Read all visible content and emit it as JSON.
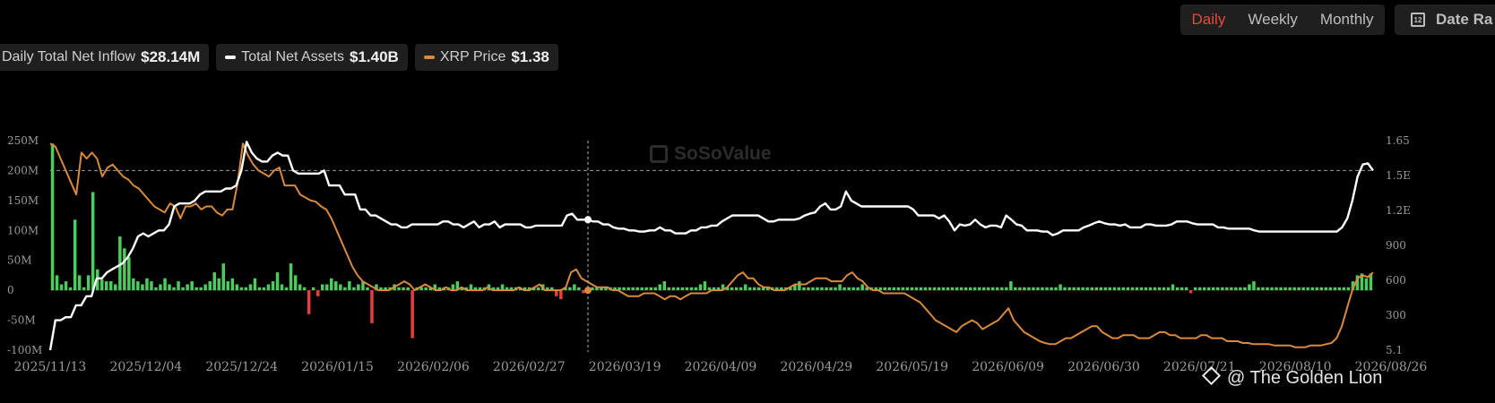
{
  "tabs": {
    "items": [
      {
        "label": "Daily",
        "active": true
      },
      {
        "label": "Weekly",
        "active": false
      },
      {
        "label": "Monthly",
        "active": false
      }
    ]
  },
  "date_range": {
    "label": "Date Ra",
    "icon": "calendar-icon",
    "icon_text": "12"
  },
  "legend": [
    {
      "label": "Daily Total Net Inflow",
      "value": "$28.14M",
      "color": "#4ecb5e"
    },
    {
      "label": "Total Net Assets",
      "value": "$1.40B",
      "color": "#ffffff"
    },
    {
      "label": "XRP Price",
      "value": "$1.38",
      "color": "#d98a3c"
    }
  ],
  "watermark": {
    "text": "SoSoValue",
    "icon": "sosovalue-logo-icon"
  },
  "credit": {
    "text": "@ The Golden Lion",
    "icon": "binance-icon"
  },
  "colors": {
    "positive": "#4ecb5e",
    "negative": "#e63f3f",
    "assets": "#ffffff",
    "price": "#d98a3c",
    "grid": "#2a2a2a"
  },
  "chart_data": {
    "type": "bar",
    "x_tick_labels": [
      "2025/11/13",
      "2025/12/04",
      "2025/12/24",
      "2026/01/15",
      "2026/02/06",
      "2026/02/27",
      "2026/03/19",
      "2026/04/09",
      "2026/04/29",
      "2026/05/19",
      "2026/06/09",
      "2026/06/30",
      "2026/07/21",
      "2026/08/10",
      "2026/08/26"
    ],
    "y_left_ticks": [
      "250M",
      "200M",
      "150M",
      "100M",
      "50M",
      "0",
      "-50M",
      "-100M"
    ],
    "y_left_ticks_values": [
      250,
      200,
      150,
      100,
      50,
      0,
      -50,
      -100
    ],
    "y_right_ticks": [
      "1.65",
      "1.5E",
      "1.2E",
      "900",
      "600",
      "300",
      "5.1"
    ],
    "y_right_ticks_values": [
      1650,
      1500,
      1200,
      900,
      600,
      300,
      50
    ],
    "ylim_left": [
      -100,
      250
    ],
    "ylim_right": [
      0,
      1650
    ],
    "series": [
      {
        "name": "Daily Total Net Inflow",
        "unit": "M",
        "type": "bar",
        "values": [
          245,
          25,
          10,
          15,
          5,
          118,
          25,
          5,
          25,
          164,
          35,
          18,
          15,
          15,
          10,
          90,
          70,
          55,
          20,
          15,
          10,
          20,
          15,
          5,
          10,
          20,
          10,
          5,
          15,
          5,
          10,
          15,
          5,
          5,
          10,
          15,
          30,
          20,
          45,
          15,
          20,
          10,
          5,
          5,
          10,
          20,
          5,
          5,
          10,
          15,
          30,
          10,
          5,
          45,
          25,
          10,
          5,
          -40,
          5,
          -10,
          10,
          10,
          20,
          15,
          10,
          5,
          15,
          5,
          10,
          15,
          5,
          -55,
          10,
          5,
          5,
          5,
          10,
          5,
          5,
          5,
          -80,
          5,
          5,
          5,
          5,
          10,
          5,
          5,
          5,
          10,
          15,
          5,
          5,
          10,
          5,
          5,
          5,
          10,
          5,
          5,
          10,
          5,
          5,
          5,
          5,
          5,
          5,
          5,
          5,
          10,
          5,
          5,
          -10,
          -15,
          5,
          5,
          10,
          5,
          -5,
          5,
          5,
          5,
          5,
          5,
          5,
          5,
          5,
          5,
          5,
          5,
          5,
          5,
          5,
          5,
          5,
          10,
          15,
          5,
          5,
          5,
          5,
          5,
          5,
          5,
          10,
          15,
          5,
          5,
          5,
          10,
          5,
          5,
          5,
          5,
          10,
          5,
          5,
          5,
          5,
          5,
          5,
          5,
          5,
          5,
          5,
          10,
          15,
          5,
          5,
          5,
          5,
          5,
          5,
          5,
          5,
          10,
          5,
          5,
          5,
          5,
          10,
          5,
          5,
          5,
          5,
          5,
          5,
          5,
          5,
          5,
          5,
          5,
          5,
          5,
          5,
          5,
          5,
          5,
          5,
          5,
          5,
          5,
          5,
          5,
          5,
          5,
          5,
          5,
          5,
          5,
          5,
          5,
          5,
          15,
          5,
          5,
          5,
          5,
          5,
          5,
          5,
          5,
          5,
          5,
          10,
          5,
          5,
          5,
          5,
          5,
          5,
          5,
          5,
          5,
          5,
          5,
          5,
          5,
          5,
          5,
          5,
          5,
          5,
          5,
          5,
          5,
          5,
          5,
          5,
          10,
          5,
          5,
          5,
          -5,
          5,
          5,
          5,
          5,
          5,
          5,
          5,
          5,
          5,
          5,
          5,
          5,
          10,
          15,
          5,
          5,
          5,
          5,
          5,
          5,
          5,
          5,
          5,
          5,
          5,
          5,
          5,
          5,
          5,
          5,
          5,
          5,
          5,
          5,
          5,
          15,
          25,
          28,
          20,
          28
        ]
      },
      {
        "name": "Total Net Assets",
        "type": "line",
        "values": [
          -100,
          -50,
          -50,
          -45,
          -45,
          -25,
          -25,
          -10,
          -10,
          20,
          20,
          30,
          35,
          40,
          45,
          55,
          70,
          90,
          95,
          90,
          95,
          100,
          100,
          110,
          140,
          145,
          145,
          145,
          150,
          160,
          165,
          165,
          165,
          165,
          170,
          170,
          175,
          200,
          248,
          230,
          220,
          215,
          215,
          225,
          230,
          225,
          225,
          200,
          195,
          195,
          195,
          195,
          195,
          200,
          175,
          175,
          175,
          160,
          160,
          160,
          135,
          135,
          125,
          125,
          120,
          115,
          110,
          110,
          105,
          105,
          110,
          110,
          110,
          110,
          110,
          110,
          115,
          115,
          110,
          110,
          105,
          110,
          115,
          105,
          110,
          110,
          115,
          105,
          110,
          110,
          110,
          110,
          105,
          105,
          108,
          108,
          108,
          108,
          108,
          108,
          125,
          128,
          118,
          118,
          118,
          115,
          115,
          110,
          110,
          105,
          103,
          103,
          100,
          100,
          98,
          98,
          100,
          100,
          105,
          100,
          100,
          95,
          95,
          95,
          100,
          100,
          105,
          105,
          108,
          108,
          115,
          120,
          125,
          125,
          125,
          125,
          125,
          125,
          120,
          115,
          115,
          118,
          118,
          118,
          118,
          120,
          125,
          128,
          130,
          140,
          145,
          135,
          135,
          140,
          165,
          150,
          145,
          140,
          140,
          140,
          140,
          140,
          140,
          140,
          140,
          140,
          140,
          135,
          125,
          125,
          125,
          125,
          120,
          125,
          115,
          100,
          110,
          108,
          110,
          118,
          110,
          105,
          108,
          108,
          105,
          125,
          118,
          110,
          108,
          100,
          100,
          100,
          98,
          98,
          92,
          95,
          100,
          100,
          100,
          100,
          105,
          108,
          112,
          115,
          112,
          110,
          110,
          108,
          110,
          105,
          105,
          105,
          110,
          110,
          108,
          108,
          108,
          110,
          115,
          115,
          115,
          112,
          110,
          110,
          110,
          110,
          105,
          105,
          103,
          103,
          103,
          103,
          103,
          100,
          98,
          98,
          98,
          98,
          98,
          98,
          98,
          98,
          98,
          98,
          98,
          98,
          98,
          98,
          98,
          98,
          105,
          120,
          150,
          190,
          210,
          212,
          200
        ]
      },
      {
        "name": "XRP Price",
        "type": "line",
        "values": [
          245,
          240,
          220,
          200,
          180,
          160,
          230,
          220,
          230,
          220,
          190,
          205,
          210,
          200,
          190,
          185,
          175,
          170,
          160,
          150,
          140,
          135,
          130,
          145,
          140,
          120,
          140,
          140,
          145,
          135,
          140,
          140,
          130,
          125,
          135,
          135,
          180,
          245,
          225,
          210,
          200,
          195,
          190,
          200,
          205,
          175,
          175,
          175,
          160,
          155,
          150,
          148,
          140,
          135,
          120,
          100,
          80,
          60,
          40,
          25,
          15,
          10,
          5,
          0,
          0,
          0,
          5,
          10,
          15,
          10,
          0,
          5,
          10,
          5,
          0,
          0,
          5,
          0,
          0,
          5,
          0,
          0,
          0,
          0,
          5,
          0,
          0,
          0,
          0,
          0,
          5,
          0,
          0,
          5,
          10,
          0,
          0,
          0,
          0,
          5,
          30,
          35,
          20,
          15,
          10,
          5,
          5,
          5,
          0,
          0,
          -5,
          -10,
          -10,
          -10,
          -5,
          -5,
          -5,
          -10,
          -15,
          -10,
          -10,
          -15,
          -10,
          -5,
          -5,
          -5,
          -5,
          0,
          0,
          0,
          5,
          15,
          25,
          30,
          20,
          20,
          10,
          5,
          5,
          0,
          0,
          0,
          5,
          10,
          10,
          10,
          15,
          20,
          20,
          20,
          15,
          15,
          15,
          25,
          30,
          20,
          15,
          5,
          0,
          0,
          -5,
          -5,
          -5,
          -5,
          -5,
          -10,
          -15,
          -20,
          -30,
          -40,
          -50,
          -55,
          -60,
          -65,
          -70,
          -60,
          -55,
          -50,
          -55,
          -65,
          -60,
          -55,
          -50,
          -40,
          -30,
          -50,
          -60,
          -70,
          -75,
          -80,
          -85,
          -88,
          -90,
          -90,
          -85,
          -80,
          -80,
          -75,
          -70,
          -65,
          -60,
          -60,
          -70,
          -75,
          -80,
          -80,
          -75,
          -75,
          -75,
          -80,
          -80,
          -80,
          -75,
          -70,
          -70,
          -75,
          -75,
          -80,
          -80,
          -80,
          -80,
          -75,
          -75,
          -80,
          -80,
          -80,
          -85,
          -85,
          -85,
          -88,
          -88,
          -90,
          -90,
          -90,
          -90,
          -92,
          -92,
          -92,
          -92,
          -95,
          -95,
          -95,
          -92,
          -92,
          -92,
          -90,
          -88,
          -80,
          -60,
          -30,
          0,
          20,
          25,
          22,
          30
        ]
      }
    ],
    "crosshair_date": "2026/03/08"
  }
}
